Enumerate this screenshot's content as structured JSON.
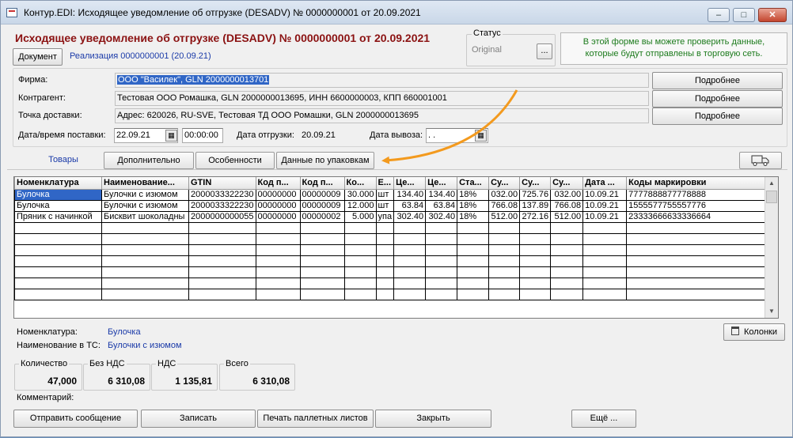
{
  "window": {
    "title": "Контур.EDI: Исходящее уведомление об отгрузке (DESADV) № 0000000001 от 20.09.2021",
    "min_label": "‒",
    "max_label": "□",
    "close_label": "✕"
  },
  "header": {
    "heading": "Исходящее уведомление об отгрузке (DESADV) № 0000000001 от 20.09.2021",
    "document_button": "Документ",
    "document_link": "Реализация   0000000001 (20.09.21)",
    "status_legend": "Статус",
    "status_value": "Original",
    "status_button": "...",
    "info": "В этой форме вы можете проверить данные, которые будут отправлены в торговую сеть."
  },
  "form": {
    "firm_label": "Фирма:",
    "firm_value": "ООО \"Василек\", GLN 2000000013701",
    "counterparty_label": "Контрагент:",
    "counterparty_value": "Тестовая ООО Ромашка, GLN 2000000013695, ИНН 6600000003, КПП 660001001",
    "delivery_point_label": "Точка доставки:",
    "delivery_point_value": "Адрес: 620026, RU-SVE, Тестовая ТД ООО Ромашки, GLN 2000000013695",
    "more_button": "Подробнее",
    "delivery_datetime_label": "Дата/время поставки:",
    "delivery_date": "22.09.21",
    "delivery_time": "00:00:00",
    "shipment_date_label": "Дата отгрузки:",
    "shipment_date": "20.09.21",
    "pickup_date_label": "Дата вывоза:",
    "pickup_date": "  .  ."
  },
  "tabs": [
    {
      "label": "Товары"
    },
    {
      "label": "Дополнительно"
    },
    {
      "label": "Особенности"
    },
    {
      "label": "Данные по упаковкам"
    }
  ],
  "grid": {
    "columns": [
      "Номенклатура",
      "Наименование...",
      "GTIN",
      "Код п...",
      "Код п...",
      "Ко...",
      "Е...",
      "Це...",
      "Це...",
      "Ста...",
      "Су...",
      "Су...",
      "Су...",
      "Дата ...",
      "Коды маркировки"
    ],
    "rows": [
      [
        "Булочка",
        "Булочки с изюмом",
        "2000033322230",
        "00000000",
        "00000009",
        "30.000",
        "шт",
        "134.40",
        "134.40",
        "18%",
        "032.00",
        "725.76",
        "032.00",
        "10.09.21",
        "7777888877778888"
      ],
      [
        "Булочка",
        "Булочки с изюмом",
        "2000033322230",
        "00000000",
        "00000009",
        "12.000",
        "шт",
        "63.84",
        "63.84",
        "18%",
        "766.08",
        "137.89",
        "766.08",
        "10.09.21",
        "1555577755557776"
      ],
      [
        "Пряник с начинкой",
        "Бисквит шоколадны",
        "2000000000055",
        "00000000",
        "00000002",
        "5.000",
        "упа",
        "302.40",
        "302.40",
        "18%",
        "512.00",
        "272.16",
        "512.00",
        "10.09.21",
        "23333666633336664"
      ]
    ]
  },
  "details": {
    "nomenclature_label": "Номенклатура:",
    "nomenclature_value": "Булочка",
    "ts_name_label": "Наименование в ТС:",
    "ts_name_value": "Булочки с изюмом",
    "columns_button": "Колонки"
  },
  "totals": {
    "quantity_label": "Количество",
    "quantity_value": "47,000",
    "without_vat_label": "Без НДС",
    "without_vat_value": "6 310,08",
    "vat_label": "НДС",
    "vat_value": "1 135,81",
    "total_label": "Всего",
    "total_value": "6 310,08"
  },
  "comment_label": "Комментарий:",
  "footer": {
    "send_button": "Отправить сообщение",
    "save_button": "Записать",
    "print_button": "Печать паллетных листов",
    "close_button": "Закрыть",
    "more_button": "Ещё ..."
  },
  "colors": {
    "heading": "#8b1212",
    "link": "#1a3aa8",
    "info_text": "#1b7a1b",
    "selection": "#3066c6",
    "annotation_arrow": "#f39a1e"
  }
}
